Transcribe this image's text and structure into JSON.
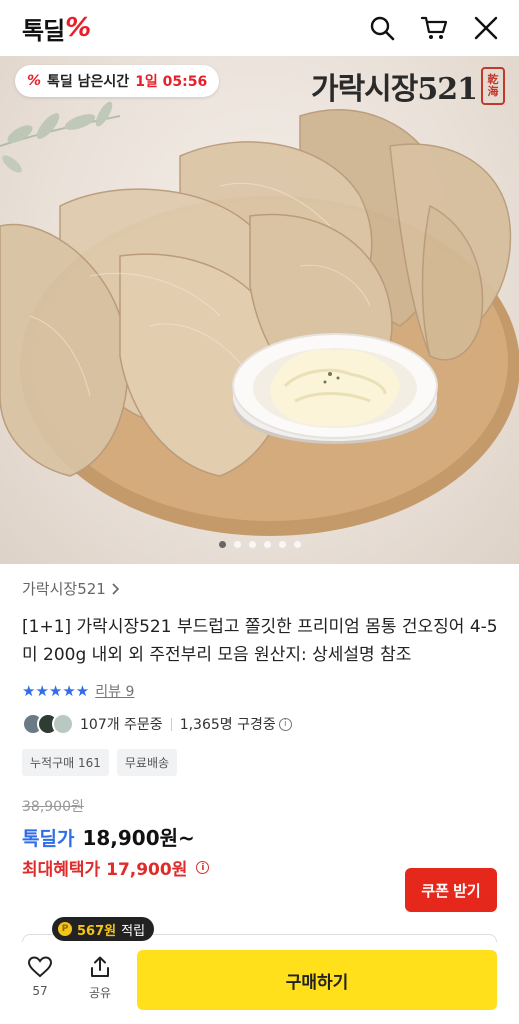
{
  "header": {
    "logo_text": "톡딜",
    "logo_mark": "%",
    "icons": [
      "search-icon",
      "cart-icon",
      "close-icon"
    ]
  },
  "hero": {
    "timer_label": "톡딜 남은시간",
    "timer_value": "1일 05:56",
    "brand_text": "가락시장521",
    "seal_chars": [
      "乾",
      "海"
    ],
    "slide_count": 6,
    "active_slide": 1
  },
  "product": {
    "store_name": "가락시장521",
    "title": "[1+1] 가락시장521 부드럽고 쫄깃한 프리미엄 몸통 건오징어 4-5미 200g 내외 외 주전부리 모음 원산지: 상세설명 참조",
    "stars": "★★★★★",
    "review_label": "리뷰 9",
    "orders_text": "107개 주문중",
    "viewers_text": "1,365명 구경중",
    "tags": [
      "누적구매 161",
      "무료배송"
    ]
  },
  "price": {
    "original": "38,900원",
    "deal_label": "톡딜가",
    "deal_price": "18,900원~",
    "max_label": "최대혜택가 17,900원",
    "coupon_button": "쿠폰 받기"
  },
  "bottom": {
    "points_amount": "567원",
    "points_suffix": "적립",
    "like_count": "57",
    "share_label": "공유",
    "buy_button": "구매하기"
  }
}
